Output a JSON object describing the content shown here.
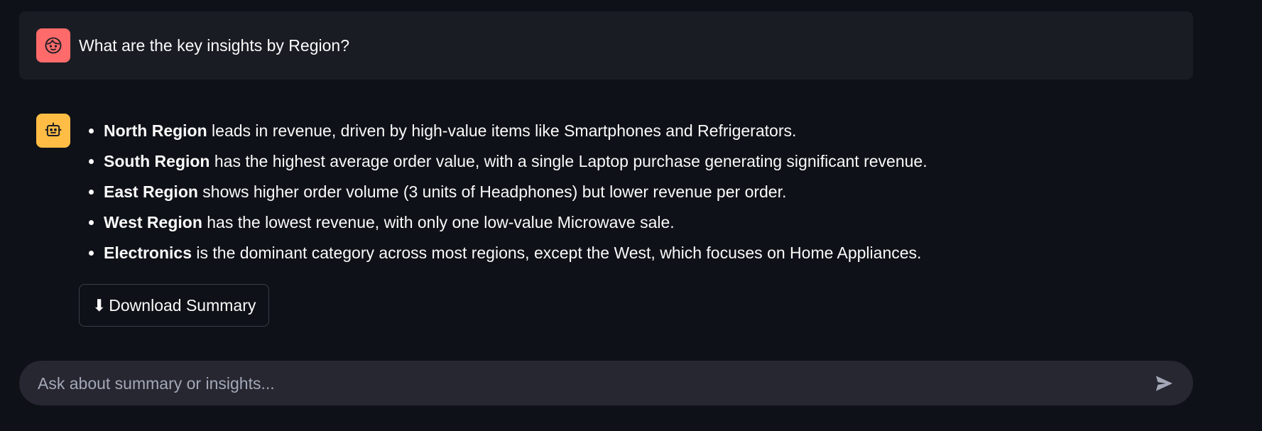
{
  "user_message": {
    "avatar_icon": "face-icon",
    "text": "What are the key insights by Region?"
  },
  "assistant_message": {
    "avatar_icon": "robot-icon",
    "insights": [
      {
        "bold": "North Region",
        "rest": " leads in revenue, driven by high-value items like Smartphones and Refrigerators."
      },
      {
        "bold": "South Region",
        "rest": " has the highest average order value, with a single Laptop purchase generating significant revenue."
      },
      {
        "bold": "East Region",
        "rest": " shows higher order volume (3 units of Headphones) but lower revenue per order."
      },
      {
        "bold": "West Region",
        "rest": " has the lowest revenue, with only one low-value Microwave sale."
      },
      {
        "bold": "Electronics",
        "rest": " is the dominant category across most regions, except the West, which focuses on Home Appliances."
      }
    ],
    "download_button": {
      "icon": "⬇",
      "label": "Download Summary"
    }
  },
  "chat_input": {
    "placeholder": "Ask about summary or insights...",
    "value": "",
    "send_icon": "send-icon"
  },
  "colors": {
    "background": "#0e1117",
    "user_bubble": "#1a1c24",
    "user_avatar": "#ff6b6b",
    "bot_avatar": "#ffbd45",
    "input_background": "#262730"
  }
}
